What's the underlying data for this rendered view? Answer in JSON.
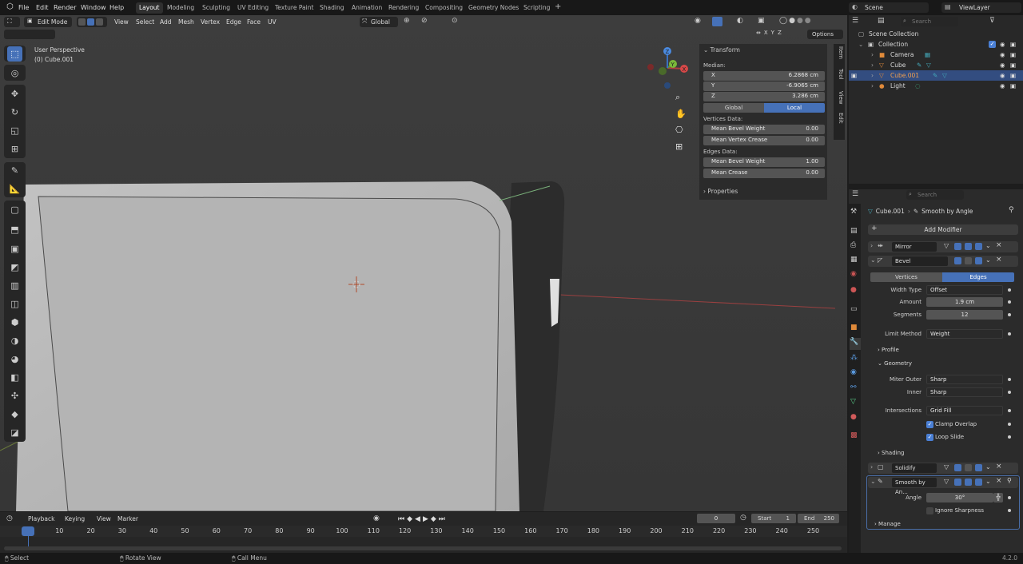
{
  "menu": {
    "items": [
      "File",
      "Edit",
      "Render",
      "Window",
      "Help"
    ]
  },
  "workspaces": [
    "Layout",
    "Modeling",
    "Sculpting",
    "UV Editing",
    "Texture Paint",
    "Shading",
    "Animation",
    "Rendering",
    "Compositing",
    "Geometry Nodes",
    "Scripting"
  ],
  "active_workspace": "Layout",
  "scene": {
    "name": "Scene",
    "view_layer": "ViewLayer"
  },
  "viewport": {
    "mode": "Edit Mode",
    "menus": [
      "View",
      "Select",
      "Add",
      "Mesh",
      "Vertex",
      "Edge",
      "Face",
      "UV"
    ],
    "orientation": "Global",
    "info_line1": "User Perspective",
    "info_line2": "(0) Cube.001",
    "options": "Options",
    "axes": [
      "X",
      "Y",
      "Z"
    ]
  },
  "npanel": {
    "section": "Transform",
    "median": "Median:",
    "x_label": "X",
    "x": "6.2868 cm",
    "y_label": "Y",
    "y": "-6.9065 cm",
    "z_label": "Z",
    "z": "3.286 cm",
    "global": "Global",
    "local": "Local",
    "vertices_data": "Vertices Data:",
    "mean_bevel_weight_label": "Mean Bevel Weight",
    "mean_bevel_weight_v": "0.00",
    "mean_vertex_crease_label": "Mean Vertex Crease",
    "mean_vertex_crease": "0.00",
    "edges_data": "Edges Data:",
    "mean_bevel_weight_e": "1.00",
    "mean_crease_label": "Mean Crease",
    "mean_crease": "0.00",
    "properties": "Properties",
    "tabs": [
      "Item",
      "Tool",
      "View",
      "Edit"
    ]
  },
  "outliner": {
    "search": "Search",
    "root": "Scene Collection",
    "collection": "Collection",
    "items": [
      "Camera",
      "Cube",
      "Cube.001",
      "Light"
    ]
  },
  "properties": {
    "search": "Search",
    "object": "Cube.001",
    "modifier_path": "Smooth by Angle",
    "add_modifier": "Add Modifier",
    "mirror": "Mirror",
    "bevel": "Bevel",
    "vertices_tab": "Vertices",
    "edges_tab": "Edges",
    "width_type_label": "Width Type",
    "width_type": "Offset",
    "amount_label": "Amount",
    "amount": "1.9 cm",
    "segments_label": "Segments",
    "segments": "12",
    "limit_method_label": "Limit Method",
    "limit_method": "Weight",
    "profile": "Profile",
    "geometry": "Geometry",
    "miter_outer_label": "Miter Outer",
    "miter_outer": "Sharp",
    "inner_label": "Inner",
    "inner": "Sharp",
    "intersections_label": "Intersections",
    "intersections": "Grid Fill",
    "clamp_overlap": "Clamp Overlap",
    "loop_slide": "Loop Slide",
    "shading": "Shading",
    "solidify": "Solidify",
    "smooth": "Smooth by An...",
    "angle_label": "Angle",
    "angle": "30°",
    "ignore_sharpness": "Ignore Sharpness",
    "manage": "Manage"
  },
  "timeline": {
    "playback": "Playback",
    "keying": "Keying",
    "view": "View",
    "marker": "Marker",
    "current": "0",
    "start_label": "Start",
    "start": "1",
    "end_label": "End",
    "end": "250",
    "ticks": [
      "0",
      "10",
      "20",
      "30",
      "40",
      "50",
      "60",
      "70",
      "80",
      "90",
      "100",
      "110",
      "120",
      "130",
      "140",
      "150",
      "160",
      "170",
      "180",
      "190",
      "200",
      "210",
      "220",
      "230",
      "240",
      "250"
    ]
  },
  "status": {
    "select": "Select",
    "rotate": "Rotate View",
    "call_menu": "Call Menu",
    "version": "4.2.0"
  }
}
